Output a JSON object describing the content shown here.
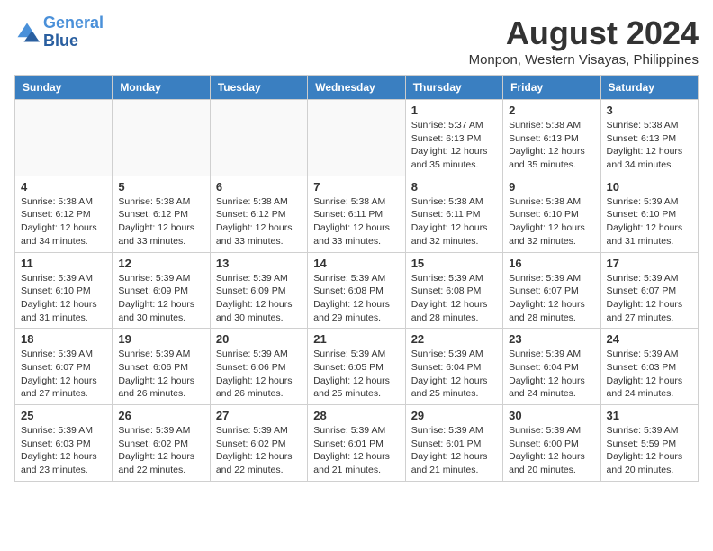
{
  "header": {
    "logo_line1": "General",
    "logo_line2": "Blue",
    "month_year": "August 2024",
    "location": "Monpon, Western Visayas, Philippines"
  },
  "weekdays": [
    "Sunday",
    "Monday",
    "Tuesday",
    "Wednesday",
    "Thursday",
    "Friday",
    "Saturday"
  ],
  "weeks": [
    [
      {
        "day": "",
        "info": ""
      },
      {
        "day": "",
        "info": ""
      },
      {
        "day": "",
        "info": ""
      },
      {
        "day": "",
        "info": ""
      },
      {
        "day": "1",
        "info": "Sunrise: 5:37 AM\nSunset: 6:13 PM\nDaylight: 12 hours\nand 35 minutes."
      },
      {
        "day": "2",
        "info": "Sunrise: 5:38 AM\nSunset: 6:13 PM\nDaylight: 12 hours\nand 35 minutes."
      },
      {
        "day": "3",
        "info": "Sunrise: 5:38 AM\nSunset: 6:13 PM\nDaylight: 12 hours\nand 34 minutes."
      }
    ],
    [
      {
        "day": "4",
        "info": "Sunrise: 5:38 AM\nSunset: 6:12 PM\nDaylight: 12 hours\nand 34 minutes."
      },
      {
        "day": "5",
        "info": "Sunrise: 5:38 AM\nSunset: 6:12 PM\nDaylight: 12 hours\nand 33 minutes."
      },
      {
        "day": "6",
        "info": "Sunrise: 5:38 AM\nSunset: 6:12 PM\nDaylight: 12 hours\nand 33 minutes."
      },
      {
        "day": "7",
        "info": "Sunrise: 5:38 AM\nSunset: 6:11 PM\nDaylight: 12 hours\nand 33 minutes."
      },
      {
        "day": "8",
        "info": "Sunrise: 5:38 AM\nSunset: 6:11 PM\nDaylight: 12 hours\nand 32 minutes."
      },
      {
        "day": "9",
        "info": "Sunrise: 5:38 AM\nSunset: 6:10 PM\nDaylight: 12 hours\nand 32 minutes."
      },
      {
        "day": "10",
        "info": "Sunrise: 5:39 AM\nSunset: 6:10 PM\nDaylight: 12 hours\nand 31 minutes."
      }
    ],
    [
      {
        "day": "11",
        "info": "Sunrise: 5:39 AM\nSunset: 6:10 PM\nDaylight: 12 hours\nand 31 minutes."
      },
      {
        "day": "12",
        "info": "Sunrise: 5:39 AM\nSunset: 6:09 PM\nDaylight: 12 hours\nand 30 minutes."
      },
      {
        "day": "13",
        "info": "Sunrise: 5:39 AM\nSunset: 6:09 PM\nDaylight: 12 hours\nand 30 minutes."
      },
      {
        "day": "14",
        "info": "Sunrise: 5:39 AM\nSunset: 6:08 PM\nDaylight: 12 hours\nand 29 minutes."
      },
      {
        "day": "15",
        "info": "Sunrise: 5:39 AM\nSunset: 6:08 PM\nDaylight: 12 hours\nand 28 minutes."
      },
      {
        "day": "16",
        "info": "Sunrise: 5:39 AM\nSunset: 6:07 PM\nDaylight: 12 hours\nand 28 minutes."
      },
      {
        "day": "17",
        "info": "Sunrise: 5:39 AM\nSunset: 6:07 PM\nDaylight: 12 hours\nand 27 minutes."
      }
    ],
    [
      {
        "day": "18",
        "info": "Sunrise: 5:39 AM\nSunset: 6:07 PM\nDaylight: 12 hours\nand 27 minutes."
      },
      {
        "day": "19",
        "info": "Sunrise: 5:39 AM\nSunset: 6:06 PM\nDaylight: 12 hours\nand 26 minutes."
      },
      {
        "day": "20",
        "info": "Sunrise: 5:39 AM\nSunset: 6:06 PM\nDaylight: 12 hours\nand 26 minutes."
      },
      {
        "day": "21",
        "info": "Sunrise: 5:39 AM\nSunset: 6:05 PM\nDaylight: 12 hours\nand 25 minutes."
      },
      {
        "day": "22",
        "info": "Sunrise: 5:39 AM\nSunset: 6:04 PM\nDaylight: 12 hours\nand 25 minutes."
      },
      {
        "day": "23",
        "info": "Sunrise: 5:39 AM\nSunset: 6:04 PM\nDaylight: 12 hours\nand 24 minutes."
      },
      {
        "day": "24",
        "info": "Sunrise: 5:39 AM\nSunset: 6:03 PM\nDaylight: 12 hours\nand 24 minutes."
      }
    ],
    [
      {
        "day": "25",
        "info": "Sunrise: 5:39 AM\nSunset: 6:03 PM\nDaylight: 12 hours\nand 23 minutes."
      },
      {
        "day": "26",
        "info": "Sunrise: 5:39 AM\nSunset: 6:02 PM\nDaylight: 12 hours\nand 22 minutes."
      },
      {
        "day": "27",
        "info": "Sunrise: 5:39 AM\nSunset: 6:02 PM\nDaylight: 12 hours\nand 22 minutes."
      },
      {
        "day": "28",
        "info": "Sunrise: 5:39 AM\nSunset: 6:01 PM\nDaylight: 12 hours\nand 21 minutes."
      },
      {
        "day": "29",
        "info": "Sunrise: 5:39 AM\nSunset: 6:01 PM\nDaylight: 12 hours\nand 21 minutes."
      },
      {
        "day": "30",
        "info": "Sunrise: 5:39 AM\nSunset: 6:00 PM\nDaylight: 12 hours\nand 20 minutes."
      },
      {
        "day": "31",
        "info": "Sunrise: 5:39 AM\nSunset: 5:59 PM\nDaylight: 12 hours\nand 20 minutes."
      }
    ]
  ]
}
